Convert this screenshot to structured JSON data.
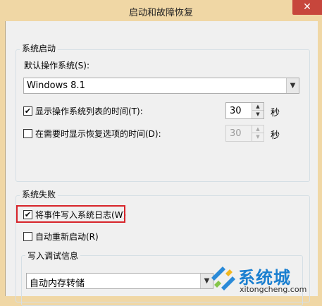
{
  "window": {
    "title": "启动和故障恢复",
    "close_label": "✕"
  },
  "system_startup": {
    "group_label": "系统启动",
    "default_os_label": "默认操作系统(S):",
    "default_os_value": "Windows 8.1",
    "show_os_list": {
      "label": "显示操作系统列表的时间(T):",
      "checked": true,
      "value": "30",
      "unit": "秒"
    },
    "show_recovery": {
      "label": "在需要时显示恢复选项的时间(D):",
      "checked": false,
      "value": "30",
      "unit": "秒"
    }
  },
  "system_failure": {
    "group_label": "系统失败",
    "write_event_log": {
      "label": "将事件写入系统日志(W)",
      "checked": true
    },
    "auto_restart": {
      "label": "自动重新启动(R)",
      "checked": false
    },
    "debug_group_label": "写入调试信息",
    "debug_select_value": "自动内存转储"
  },
  "watermark": {
    "name": "系统城",
    "url": "xitongcheng.com",
    "logo_icon": "xitongcheng-logo-icon"
  }
}
